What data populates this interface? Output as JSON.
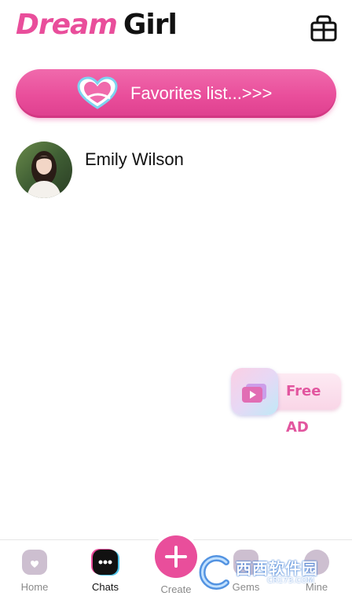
{
  "header": {
    "logo_word1": "Dream",
    "logo_word2": "Girl",
    "shop_icon": "gift-box-icon"
  },
  "favorites_banner": {
    "label": "Favorites list...>>>",
    "icon": "heart-icon"
  },
  "chats": [
    {
      "name": "Emily Wilson",
      "avatar": "avatar-photo"
    }
  ],
  "free_ad": {
    "label": "Free AD",
    "icon": "video-play-icon"
  },
  "bottom_nav": {
    "items": [
      {
        "label": "Home",
        "icon": "home-icon",
        "active": false
      },
      {
        "label": "Chats",
        "icon": "chat-bubble-icon",
        "active": true
      },
      {
        "label": "Create",
        "icon": "plus-icon",
        "active": false
      },
      {
        "label": "Gems",
        "icon": "gem-icon",
        "active": false
      },
      {
        "label": "Mine",
        "icon": "profile-icon",
        "active": false
      }
    ]
  },
  "watermark": {
    "brand": "西西软件园",
    "site": "CR173.COM"
  },
  "colors": {
    "accent": "#e94e9b",
    "text": "#111111",
    "muted": "#8a8a8a"
  }
}
